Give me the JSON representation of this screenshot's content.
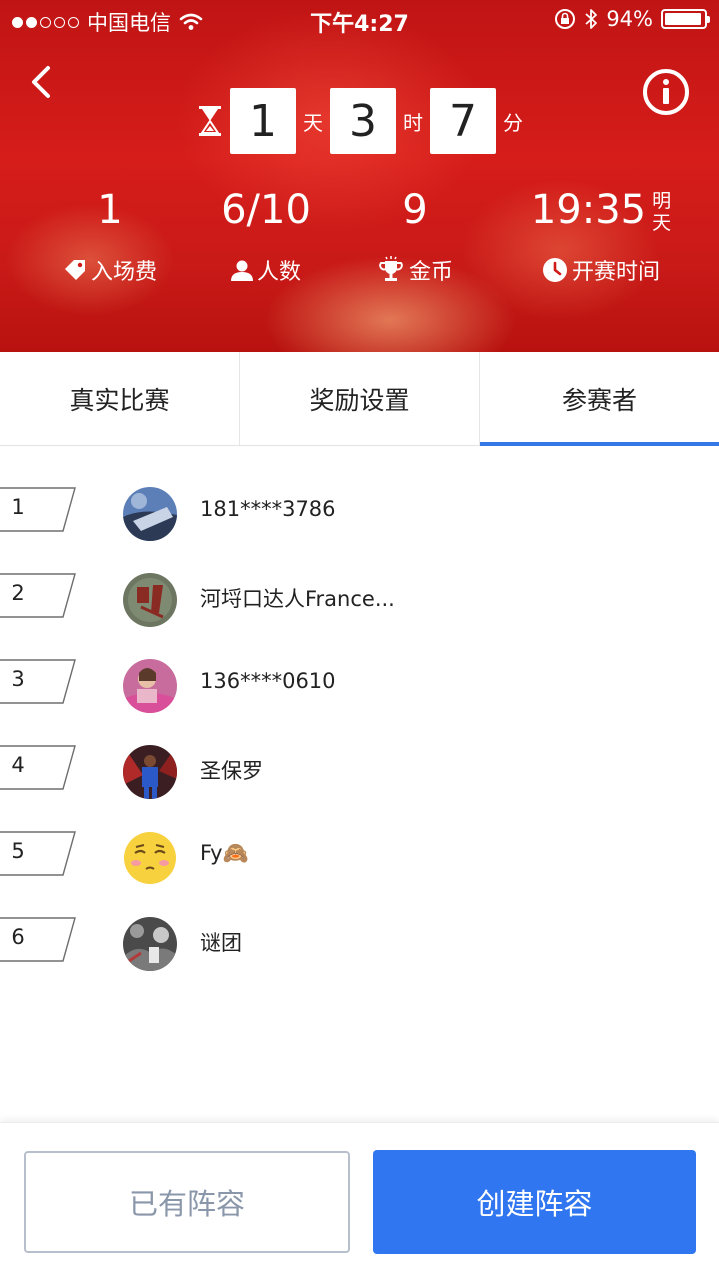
{
  "status_bar": {
    "carrier": "中国电信",
    "time": "下午4:27",
    "battery": "94%"
  },
  "countdown": {
    "days": "1",
    "days_unit": "天",
    "hours": "3",
    "hours_unit": "时",
    "minutes": "7",
    "minutes_unit": "分"
  },
  "stats": {
    "entry_fee": {
      "value": "1",
      "label": "入场费",
      "icon": "ticket-icon"
    },
    "participants": {
      "value": "6/10",
      "label": "人数",
      "icon": "person-icon"
    },
    "coins": {
      "value": "9",
      "label": "金币",
      "icon": "trophy-icon"
    },
    "start_time": {
      "value": "19:35",
      "suffix_line1": "明",
      "suffix_line2": "天",
      "label": "开赛时间",
      "icon": "clock-icon"
    }
  },
  "tabs": [
    {
      "label": "真实比赛",
      "active": false
    },
    {
      "label": "奖励设置",
      "active": false
    },
    {
      "label": "参赛者",
      "active": true
    }
  ],
  "participants": [
    {
      "rank": "1",
      "name": "181****3786"
    },
    {
      "rank": "2",
      "name": "河埒口达人France..."
    },
    {
      "rank": "3",
      "name": "136****0610"
    },
    {
      "rank": "4",
      "name": "圣保罗"
    },
    {
      "rank": "5",
      "name": "Fy🙈"
    },
    {
      "rank": "6",
      "name": "谜团"
    }
  ],
  "footer": {
    "existing_lineup": "已有阵容",
    "create_lineup": "创建阵容"
  },
  "colors": {
    "accent_blue": "#2f76f0",
    "header_red": "#d61d1a"
  }
}
